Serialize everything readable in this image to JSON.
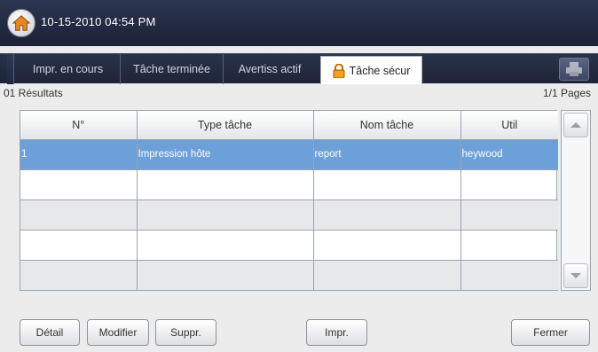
{
  "header": {
    "datetime": "10-15-2010 04:54 PM"
  },
  "tabs": [
    {
      "label": "Impr. en cours"
    },
    {
      "label": "Tâche terminée"
    },
    {
      "label": "Avertiss actif"
    },
    {
      "label": "Tâche sécur",
      "active": true
    }
  ],
  "status": {
    "results": "01 Résultats",
    "pages": "1/1 Pages"
  },
  "table": {
    "columns": [
      "N°",
      "Type tâche",
      "Nom tâche",
      "Util"
    ],
    "rows": [
      [
        "1",
        "Impression hôte",
        "report",
        "heywood"
      ],
      [
        "",
        "",
        "",
        ""
      ],
      [
        "",
        "",
        "",
        ""
      ],
      [
        "",
        "",
        "",
        ""
      ],
      [
        "",
        "",
        "",
        ""
      ]
    ]
  },
  "buttons": {
    "detail": "Détail",
    "modifier": "Modifier",
    "suppr": "Suppr.",
    "impr": "Impr.",
    "fermer": "Fermer"
  },
  "colors": {
    "accent_selected": "#6d9fd9",
    "header_bg": "#1b2236"
  }
}
